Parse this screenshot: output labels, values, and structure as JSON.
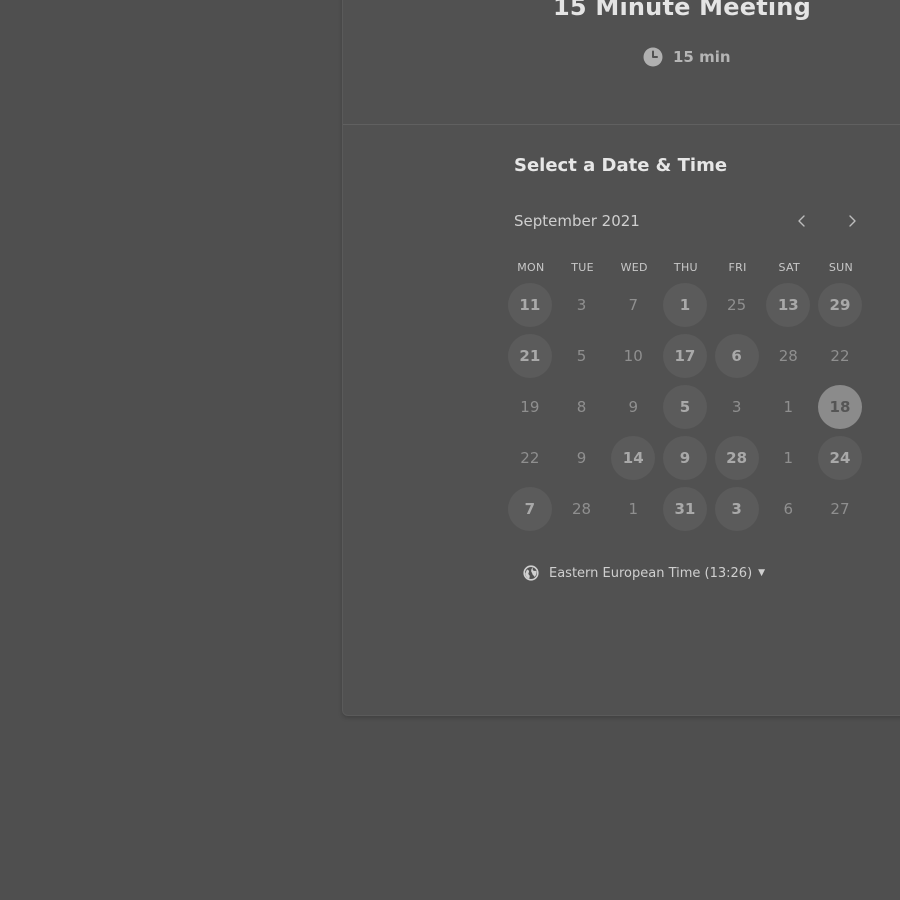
{
  "event": {
    "title": "15 Minute Meeting",
    "duration": "15 min",
    "duration_icon": "clock-icon"
  },
  "scheduler": {
    "heading": "Select a Date & Time",
    "month": "September 2021",
    "prev_icon": "chevron-left-icon",
    "next_icon": "chevron-right-icon",
    "weekdays": [
      "MON",
      "TUE",
      "WED",
      "THU",
      "FRI",
      "SAT",
      "SUN"
    ],
    "days": [
      {
        "label": "11",
        "state": "available"
      },
      {
        "label": "3",
        "state": "unavailable"
      },
      {
        "label": "7",
        "state": "unavailable"
      },
      {
        "label": "1",
        "state": "available"
      },
      {
        "label": "25",
        "state": "unavailable"
      },
      {
        "label": "13",
        "state": "available"
      },
      {
        "label": "29",
        "state": "available"
      },
      {
        "label": "21",
        "state": "available"
      },
      {
        "label": "5",
        "state": "unavailable"
      },
      {
        "label": "10",
        "state": "unavailable"
      },
      {
        "label": "17",
        "state": "available"
      },
      {
        "label": "6",
        "state": "available"
      },
      {
        "label": "28",
        "state": "unavailable"
      },
      {
        "label": "22",
        "state": "unavailable"
      },
      {
        "label": "19",
        "state": "unavailable"
      },
      {
        "label": "8",
        "state": "unavailable"
      },
      {
        "label": "9",
        "state": "unavailable"
      },
      {
        "label": "5",
        "state": "available"
      },
      {
        "label": "3",
        "state": "unavailable"
      },
      {
        "label": "1",
        "state": "unavailable"
      },
      {
        "label": "18",
        "state": "selected"
      },
      {
        "label": "22",
        "state": "unavailable"
      },
      {
        "label": "9",
        "state": "unavailable"
      },
      {
        "label": "14",
        "state": "available"
      },
      {
        "label": "9",
        "state": "available"
      },
      {
        "label": "28",
        "state": "available"
      },
      {
        "label": "1",
        "state": "unavailable"
      },
      {
        "label": "24",
        "state": "available"
      },
      {
        "label": "7",
        "state": "available"
      },
      {
        "label": "28",
        "state": "unavailable"
      },
      {
        "label": "1",
        "state": "unavailable"
      },
      {
        "label": "31",
        "state": "available"
      },
      {
        "label": "3",
        "state": "available"
      },
      {
        "label": "6",
        "state": "unavailable"
      },
      {
        "label": "27",
        "state": "unavailable"
      }
    ]
  },
  "timezone": {
    "label": "Eastern European Time (13:26)",
    "icon": "globe-icon",
    "caret_icon": "caret-down-icon"
  },
  "colors": {
    "background": "#4f4f4f",
    "card": "#515151",
    "available_day_bg": "#5b5b5b",
    "selected_day_bg": "#8b8b8b"
  }
}
